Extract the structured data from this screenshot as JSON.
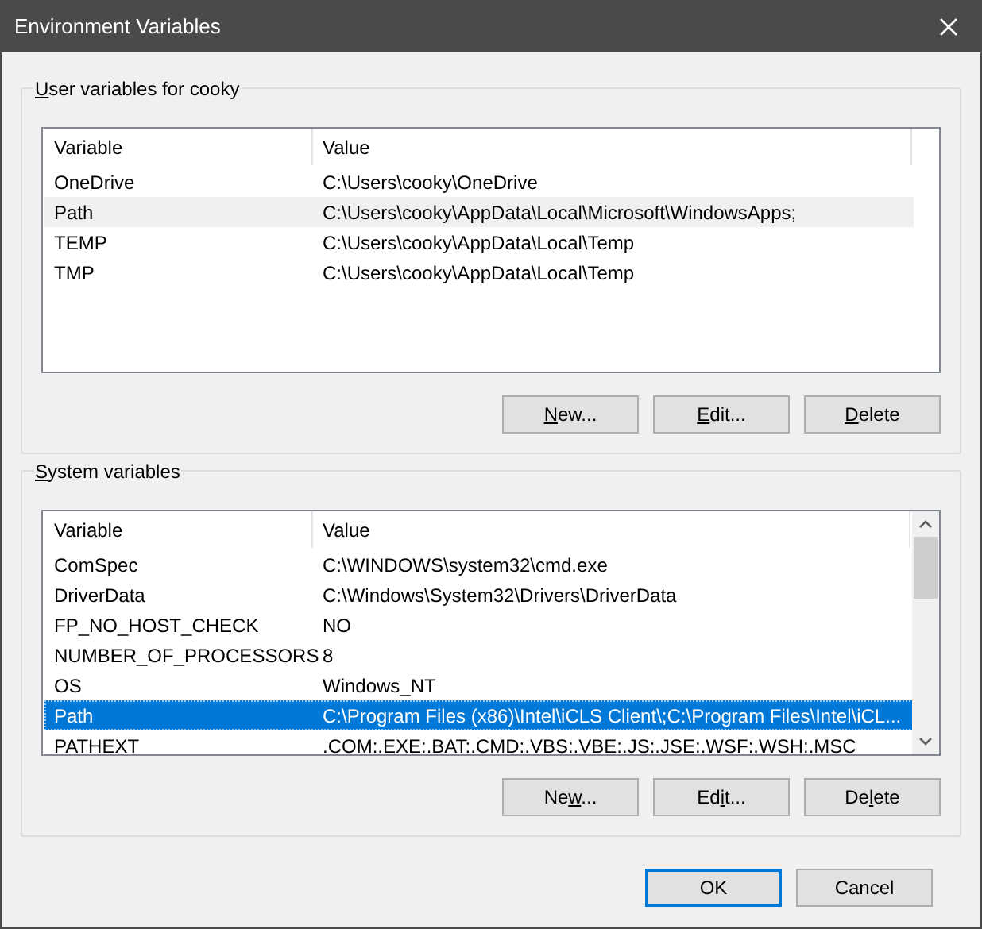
{
  "window": {
    "title": "Environment Variables"
  },
  "groups": [
    {
      "label": {
        "key": "U",
        "after": "ser variables for cooky"
      },
      "table": {
        "focused": false,
        "scrollbar": false,
        "columns": [
          "Variable",
          "Value"
        ],
        "rows": [
          {
            "cells": [
              "OneDrive",
              "C:\\Users\\cooky\\OneDrive"
            ],
            "selected": false
          },
          {
            "cells": [
              "Path",
              "C:\\Users\\cooky\\AppData\\Local\\Microsoft\\WindowsApps;"
            ],
            "selected": true
          },
          {
            "cells": [
              "TEMP",
              "C:\\Users\\cooky\\AppData\\Local\\Temp"
            ],
            "selected": false
          },
          {
            "cells": [
              "TMP",
              "C:\\Users\\cooky\\AppData\\Local\\Temp"
            ],
            "selected": false
          }
        ]
      },
      "buttons": [
        {
          "key": "N",
          "after": "ew..."
        },
        {
          "key": "E",
          "after": "dit..."
        },
        {
          "key": "D",
          "after": "elete"
        }
      ]
    },
    {
      "label": {
        "key": "S",
        "after": "ystem variables"
      },
      "table": {
        "focused": true,
        "scrollbar": true,
        "columns": [
          "Variable",
          "Value"
        ],
        "rows": [
          {
            "cells": [
              "ComSpec",
              "C:\\WINDOWS\\system32\\cmd.exe"
            ],
            "selected": false
          },
          {
            "cells": [
              "DriverData",
              "C:\\Windows\\System32\\Drivers\\DriverData"
            ],
            "selected": false
          },
          {
            "cells": [
              "FP_NO_HOST_CHECK",
              "NO"
            ],
            "selected": false
          },
          {
            "cells": [
              "NUMBER_OF_PROCESSORS",
              "8"
            ],
            "selected": false
          },
          {
            "cells": [
              "OS",
              "Windows_NT"
            ],
            "selected": false
          },
          {
            "cells": [
              "Path",
              "C:\\Program Files (x86)\\Intel\\iCLS Client\\;C:\\Program Files\\Intel\\iCL..."
            ],
            "selected": true
          },
          {
            "cells": [
              "PATHEXT",
              ".COM:.EXE:.BAT:.CMD:.VBS:.VBE:.JS:.JSE:.WSF:.WSH:.MSC"
            ],
            "selected": false
          }
        ]
      },
      "buttons": [
        {
          "before": "Ne",
          "key": "w",
          "after": "..."
        },
        {
          "before": "Ed",
          "key": "i",
          "after": "t..."
        },
        {
          "before": "De",
          "key": "l",
          "after": "ete"
        }
      ]
    }
  ],
  "footer_buttons": [
    {
      "label": "OK",
      "default": true
    },
    {
      "label": "Cancel",
      "default": false
    }
  ]
}
